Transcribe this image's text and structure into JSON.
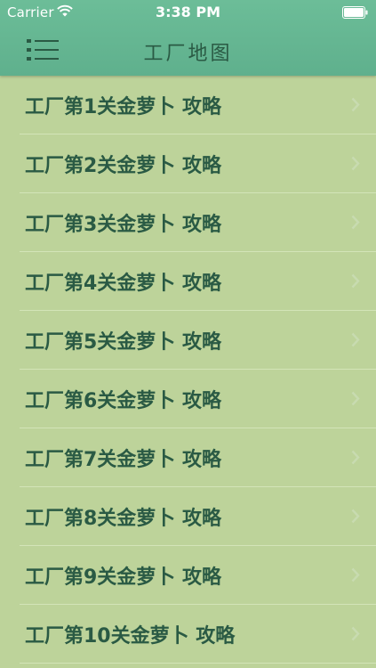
{
  "status_bar": {
    "carrier": "Carrier",
    "time": "3:38 PM"
  },
  "nav_bar": {
    "title": "工厂地图",
    "menu_icon": "menu-list-icon"
  },
  "list": {
    "items": [
      {
        "label": "工厂第1关金萝卜 攻略"
      },
      {
        "label": "工厂第2关金萝卜 攻略"
      },
      {
        "label": "工厂第3关金萝卜 攻略"
      },
      {
        "label": "工厂第4关金萝卜 攻略"
      },
      {
        "label": "工厂第5关金萝卜 攻略"
      },
      {
        "label": "工厂第6关金萝卜 攻略"
      },
      {
        "label": "工厂第7关金萝卜 攻略"
      },
      {
        "label": "工厂第8关金萝卜 攻略"
      },
      {
        "label": "工厂第9关金萝卜 攻略"
      },
      {
        "label": "工厂第10关金萝卜 攻略"
      }
    ]
  },
  "colors": {
    "background": "#bdd39a",
    "nav_bar": "#62b48f",
    "text": "#2a5a44",
    "chevron": "#c8dbb0"
  }
}
